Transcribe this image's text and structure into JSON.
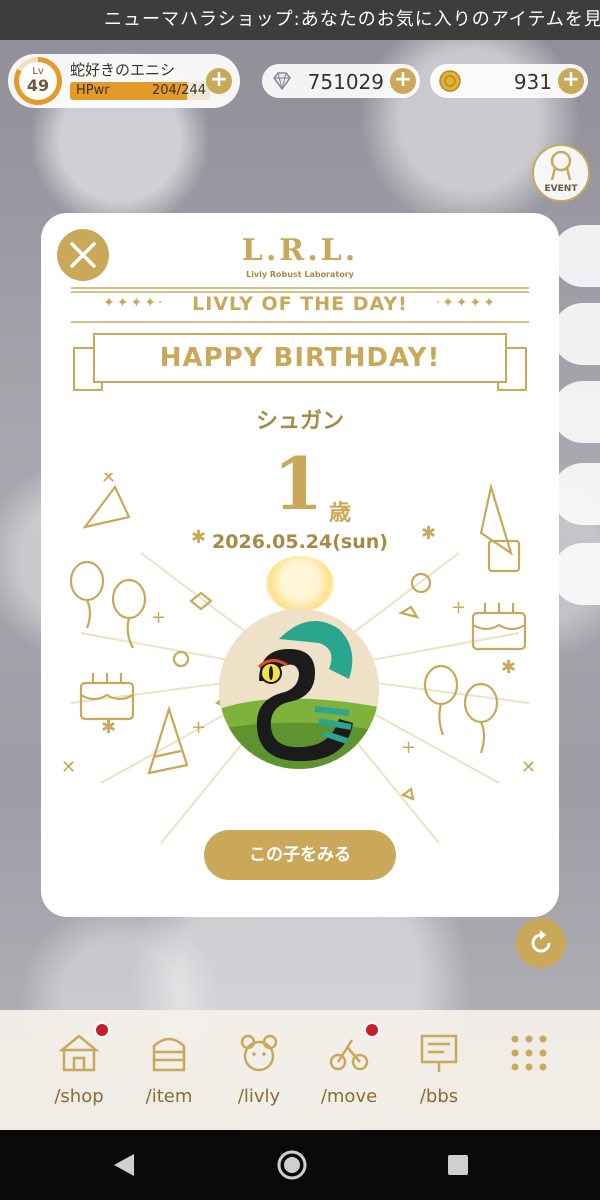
{
  "ticker": "ニューマハラショップ:あなたのお気に入りのアイテムを見つけよう",
  "player": {
    "level_tag": "Lv",
    "level": "49",
    "name": "蛇好きのエニシ",
    "hp_label": "HPwr",
    "hp_value": "204/244",
    "hp_fraction": 0.836
  },
  "currency": {
    "gems": "751029",
    "coins": "931"
  },
  "event_label": "EVENT",
  "modal": {
    "brand": "L.R.L.",
    "brand_sub": "Livly Robust Laboratory",
    "title": "LIVLY OF THE DAY!",
    "banner": "HAPPY BIRTHDAY!",
    "livly_name": "シュガン",
    "age": "1",
    "age_unit": "歳",
    "birthday": "2026.05.24(sun)",
    "view_button": "この子をみる"
  },
  "nav": {
    "shop": "/shop",
    "item": "/item",
    "livly": "/livly",
    "move": "/move",
    "bbs": "/bbs"
  },
  "colors": {
    "gold": "#c9a85a",
    "orange": "#e39a2a",
    "notify": "#c0202b"
  }
}
